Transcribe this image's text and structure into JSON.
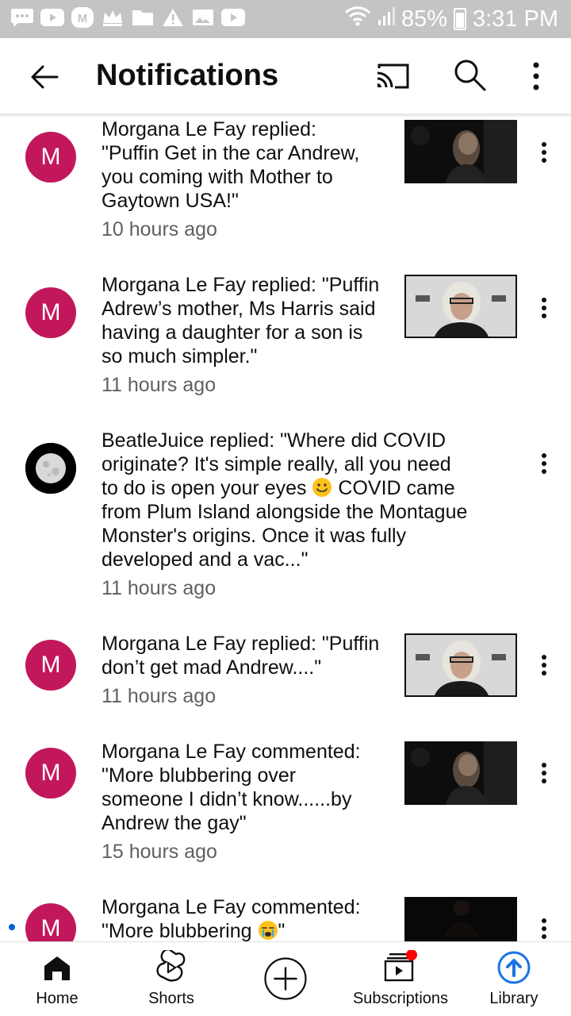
{
  "status_bar": {
    "battery": "85%",
    "time": "3:31 PM",
    "icons": [
      "message-icon",
      "youtube-icon",
      "mobile-app-icon",
      "crown-icon",
      "folder-icon",
      "warning-icon",
      "gallery-icon",
      "youtube-icon",
      "wifi-icon",
      "signal-icon",
      "battery-icon"
    ]
  },
  "appbar": {
    "title": "Notifications",
    "icons": [
      "back-arrow-icon",
      "cast-icon",
      "search-icon",
      "more-vert-icon"
    ]
  },
  "notifications": [
    {
      "avatar_letter": "M",
      "avatar_color": "#c2185b",
      "text_lines": [
        "Morgana Le Fay replied:",
        "\"Puffin Get in the car Andrew,",
        "you coming with Mother to",
        "Gaytown USA!\""
      ],
      "time": "10 hours ago",
      "thumbnail": "dark-portrait"
    },
    {
      "avatar_letter": "M",
      "avatar_color": "#c2185b",
      "text_lines": [
        "Morgana Le Fay replied: \"Puffin",
        "Adrew’s mother, Ms Harris said",
        "having a daughter for a son is",
        "so much simpler.\""
      ],
      "time": "11 hours ago",
      "thumbnail": "grey-haired-man"
    },
    {
      "avatar_letter": "",
      "avatar_color": "#000000",
      "avatar_icon": "moon-icon",
      "text_lines": [
        "BeatleJuice replied: \"Where did COVID",
        "originate? It's simple really, all you need",
        "to do is open your eyes",
        "COVID came",
        "from Plum Island alongside the Montague",
        "Monster's origins. Once it was fully",
        "developed and a vac...\""
      ],
      "time": "11 hours ago",
      "thumbnail": "none"
    },
    {
      "avatar_letter": "M",
      "avatar_color": "#c2185b",
      "text_lines": [
        "Morgana Le Fay replied: \"Puffin",
        "don’t get mad Andrew....\""
      ],
      "time": "11 hours ago",
      "thumbnail": "grey-haired-man"
    },
    {
      "avatar_letter": "M",
      "avatar_color": "#c2185b",
      "text_lines": [
        "Morgana Le Fay commented:",
        "\"More blubbering over",
        "someone I didn’t know......by",
        "Andrew the gay\""
      ],
      "time": "15 hours ago",
      "thumbnail": "dark-portrait"
    },
    {
      "avatar_letter": "M",
      "avatar_color": "#c2185b",
      "text_lines": [
        "Morgana Le Fay commented:",
        "\"More blubbering",
        "\""
      ],
      "time": "",
      "thumbnail": "very-dark",
      "unread": true
    }
  ],
  "bottom_nav": {
    "items": [
      {
        "label": "Home",
        "icon": "home-icon"
      },
      {
        "label": "Shorts",
        "icon": "shorts-icon"
      },
      {
        "label": "",
        "icon": "create-plus-icon"
      },
      {
        "label": "Subscriptions",
        "icon": "subscriptions-icon"
      },
      {
        "label": "Library",
        "icon": "library-icon"
      }
    ],
    "accent": "#1a73e8",
    "badge_color": "#ff0000"
  }
}
